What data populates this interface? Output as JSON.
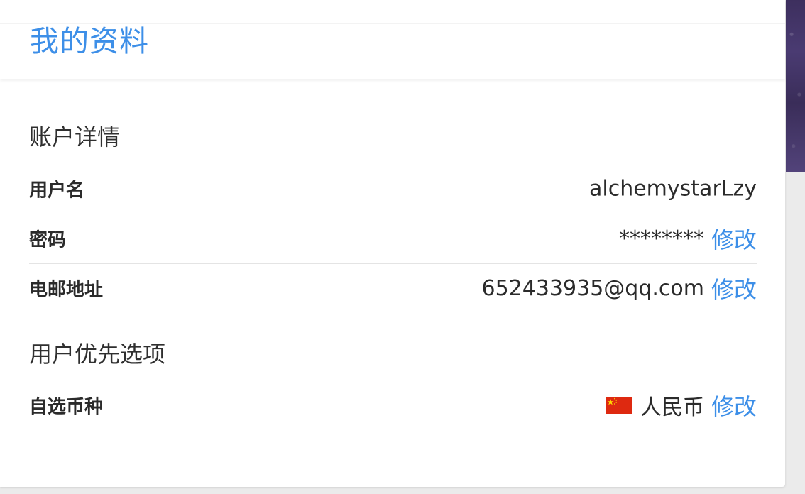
{
  "header": {
    "title": "我的资料"
  },
  "account_details": {
    "section_title": "账户详情",
    "rows": [
      {
        "label": "用户名",
        "value": "alchemystarLzy"
      },
      {
        "label": "密码",
        "value": "********",
        "action": "修改"
      },
      {
        "label": "电邮地址",
        "value": "652433935@qq.com",
        "action": "修改"
      }
    ]
  },
  "preferences": {
    "section_title": "用户优先选项",
    "rows": [
      {
        "label": "自选币种",
        "value": "人民币",
        "icon": "china-flag-icon",
        "action": "修改"
      }
    ]
  },
  "colors": {
    "accent": "#3d8fe8",
    "flag_red": "#de2910",
    "flag_yellow": "#ffde00"
  }
}
